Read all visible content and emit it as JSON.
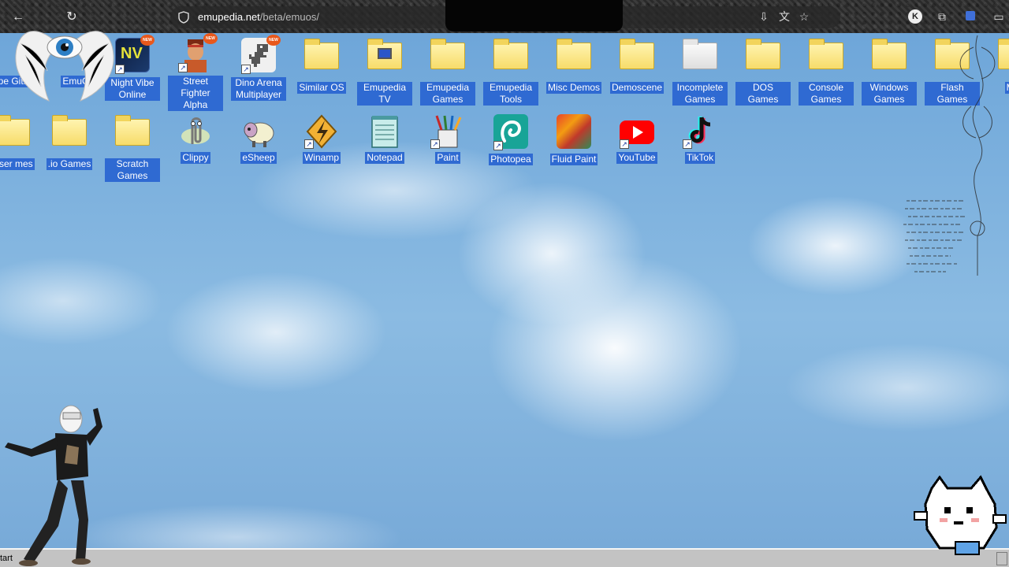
{
  "browser": {
    "url_host": "emupedia.net",
    "url_path": "/beta/emuos/",
    "profile_initial": "K"
  },
  "desktop": {
    "row1": [
      {
        "label": "upe GitHu",
        "kind": "partial"
      },
      {
        "label": "EmuC",
        "kind": "partial"
      },
      {
        "label": "Night Vibe Online",
        "kind": "app"
      },
      {
        "label": "Street Fighter Alpha",
        "kind": "app"
      },
      {
        "label": "Dino Arena Multiplayer",
        "kind": "app"
      },
      {
        "label": "Similar OS",
        "kind": "folder"
      },
      {
        "label": "Emupedia TV",
        "kind": "app"
      },
      {
        "label": "Emupedia Games",
        "kind": "folder"
      },
      {
        "label": "Emupedia Tools",
        "kind": "folder"
      },
      {
        "label": "Misc Demos",
        "kind": "folder"
      },
      {
        "label": "Demoscene",
        "kind": "folder"
      },
      {
        "label": "Incomplete Games",
        "kind": "folder"
      },
      {
        "label": "DOS Games",
        "kind": "folder"
      },
      {
        "label": "Console Games",
        "kind": "folder"
      },
      {
        "label": "Windows Games",
        "kind": "folder"
      },
      {
        "label": "Flash Games",
        "kind": "folder"
      },
      {
        "label": "M G",
        "kind": "partial"
      }
    ],
    "row2": [
      {
        "label": "wser mes",
        "kind": "partial"
      },
      {
        "label": ".io Games",
        "kind": "folder"
      },
      {
        "label": "Scratch Games",
        "kind": "folder"
      },
      {
        "label": "Clippy",
        "kind": "app"
      },
      {
        "label": "eSheep",
        "kind": "app"
      },
      {
        "label": "Winamp",
        "kind": "app"
      },
      {
        "label": "Notepad",
        "kind": "app"
      },
      {
        "label": "Paint",
        "kind": "app"
      },
      {
        "label": "Photopea",
        "kind": "app"
      },
      {
        "label": "Fluid Paint",
        "kind": "app"
      },
      {
        "label": "YouTube",
        "kind": "app"
      },
      {
        "label": "TikTok",
        "kind": "app"
      }
    ],
    "new_badge": "NEW"
  },
  "taskbar": {
    "start_label": "tart"
  },
  "colors": {
    "label_bg": "#2f6ad2",
    "taskbar": "#c3c3c3"
  }
}
